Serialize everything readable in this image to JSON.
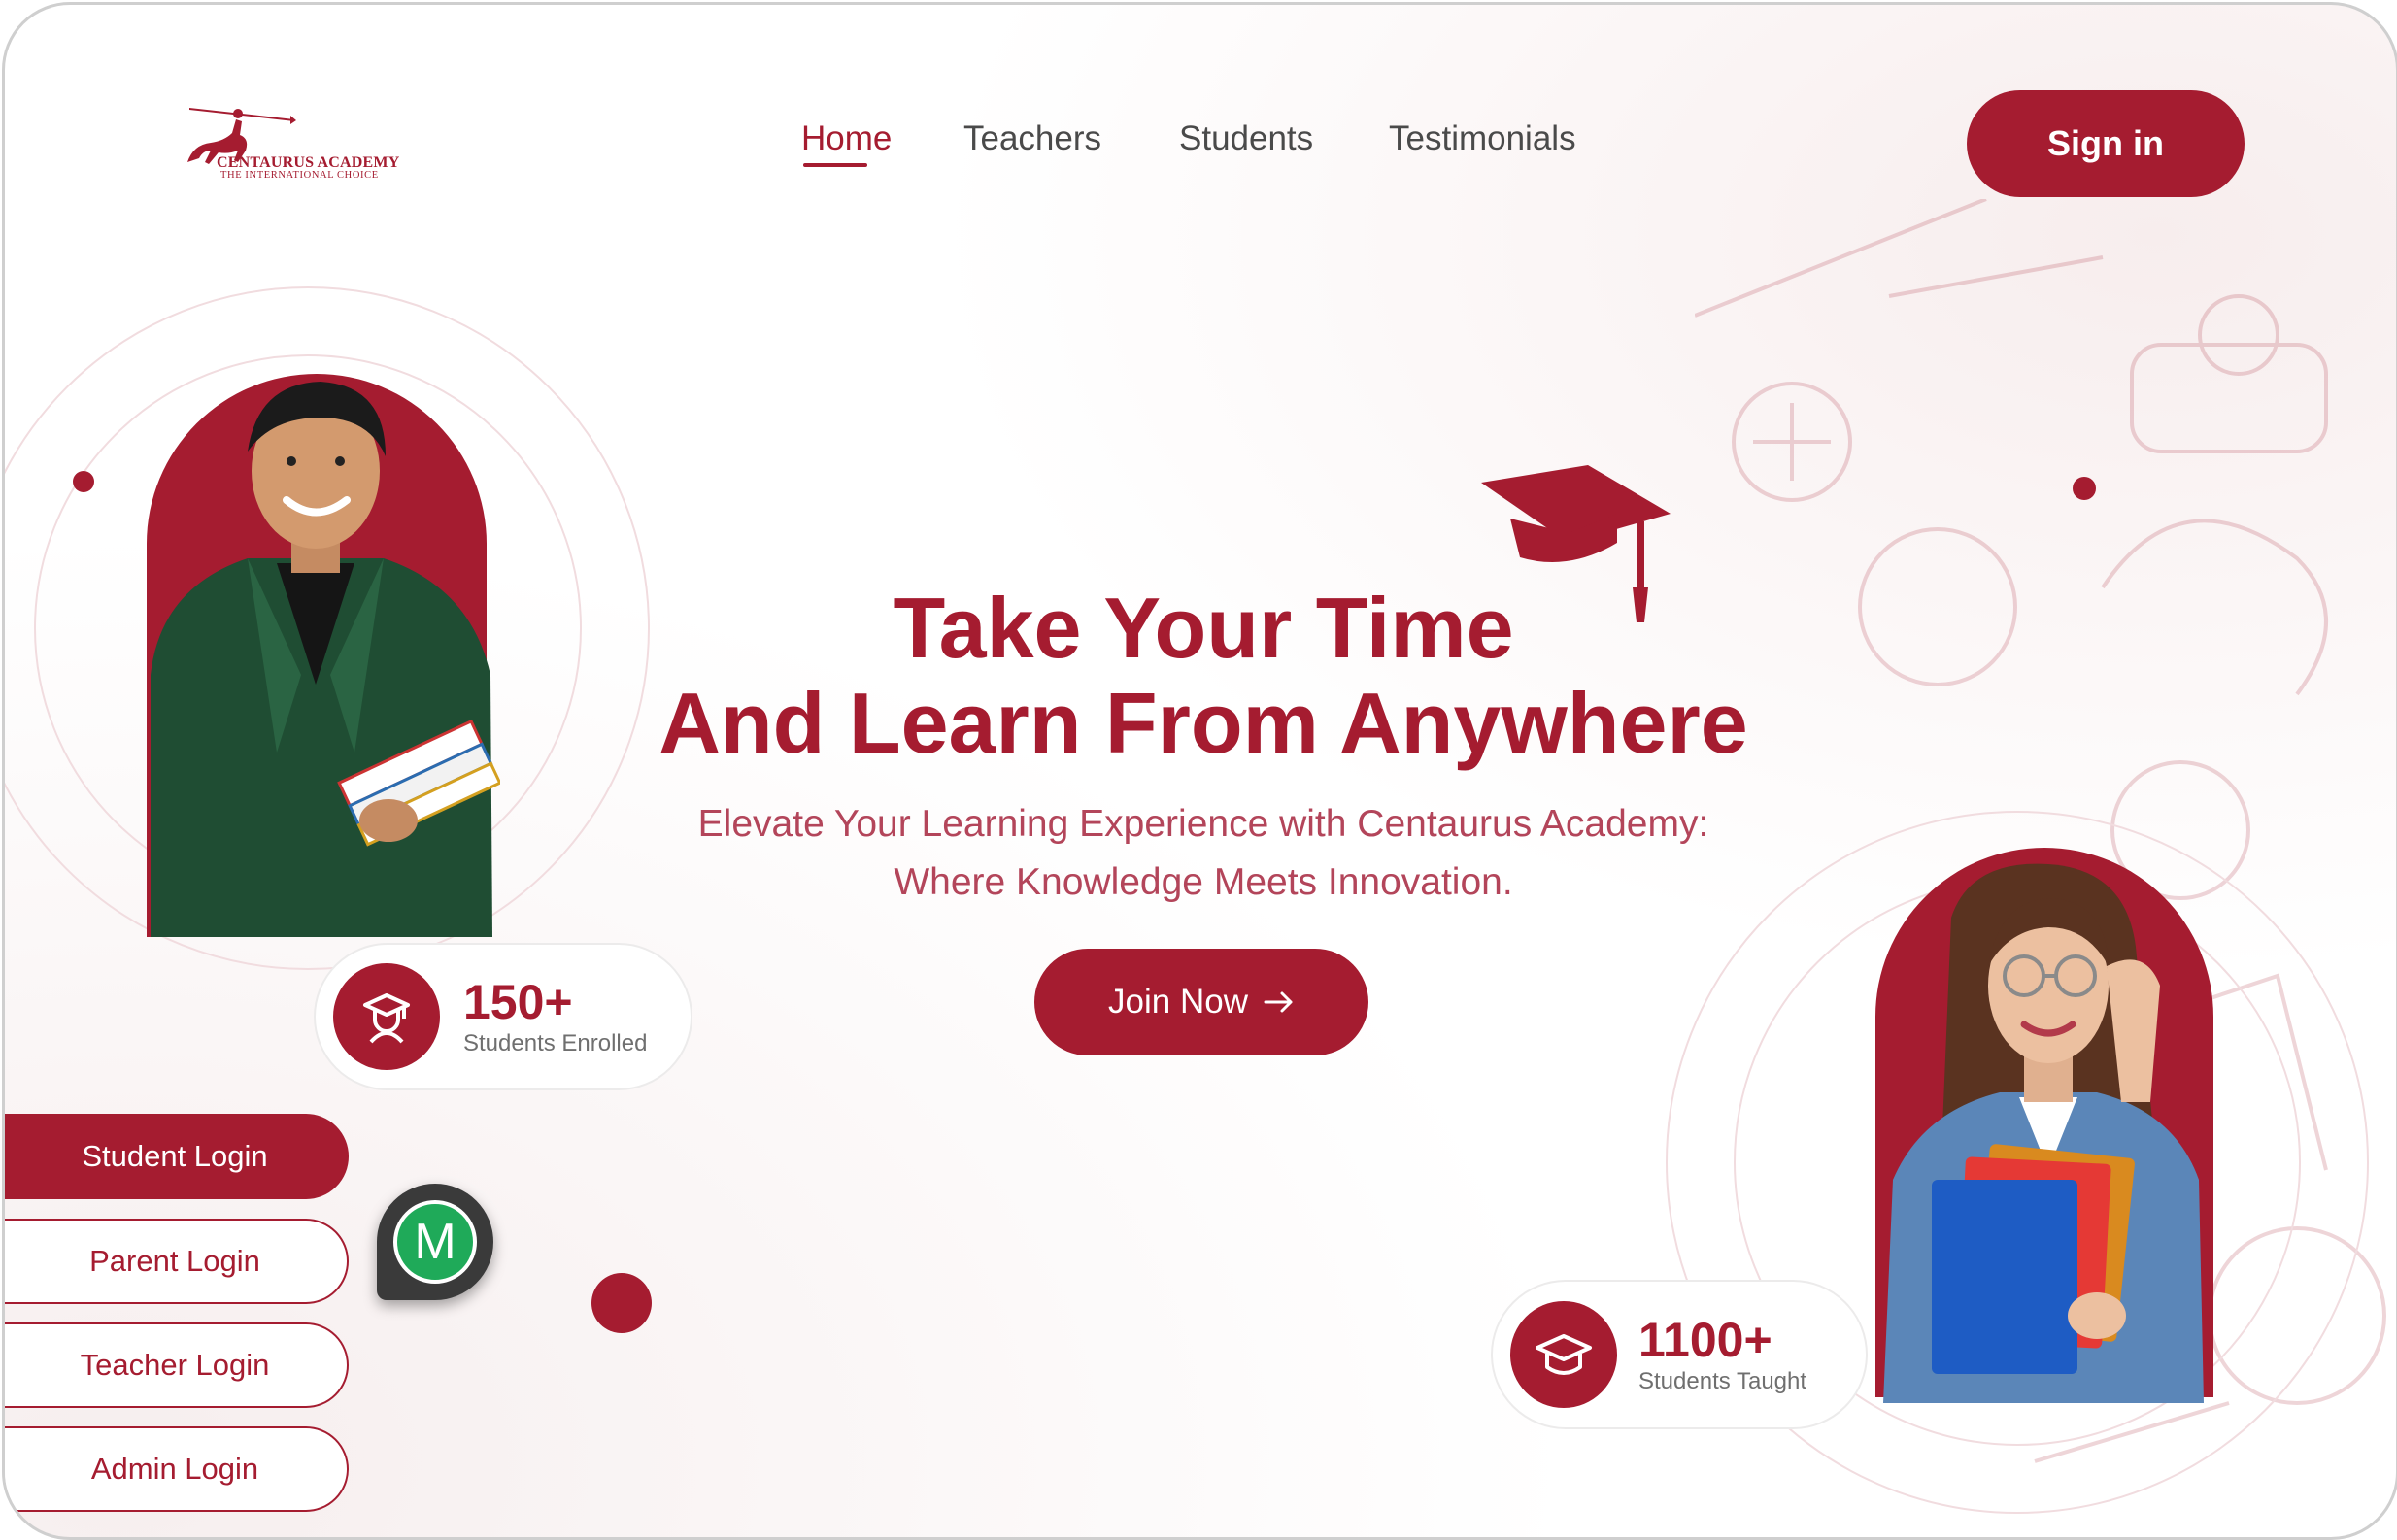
{
  "brand": {
    "name": "CENTAURUS ACADEMY",
    "tagline": "THE INTERNATIONAL CHOICE",
    "accent_color": "#a51c30"
  },
  "nav": {
    "items": [
      {
        "label": "Home",
        "active": true
      },
      {
        "label": "Teachers",
        "active": false
      },
      {
        "label": "Students",
        "active": false
      },
      {
        "label": "Testimonials",
        "active": false
      }
    ],
    "sign_in": "Sign in"
  },
  "hero": {
    "title_line1": "Take Your Time",
    "title_line2": "And Learn From Anywhere",
    "subtitle_line1": "Elevate Your Learning Experience with Centaurus Academy:",
    "subtitle_line2": "Where Knowledge Meets Innovation.",
    "cta": "Join Now",
    "cta_icon": "arrow-right-icon"
  },
  "stats": [
    {
      "value": "150+",
      "label": "Students Enrolled",
      "icon": "student-icon"
    },
    {
      "value": "1100+",
      "label": "Students Taught",
      "icon": "graduation-cap-icon"
    }
  ],
  "logins": [
    {
      "label": "Student Login",
      "primary": true
    },
    {
      "label": "Parent Login",
      "primary": false
    },
    {
      "label": "Teacher Login",
      "primary": false
    },
    {
      "label": "Admin Login",
      "primary": false
    }
  ],
  "badge": {
    "letter": "M",
    "color": "#1faa59"
  }
}
